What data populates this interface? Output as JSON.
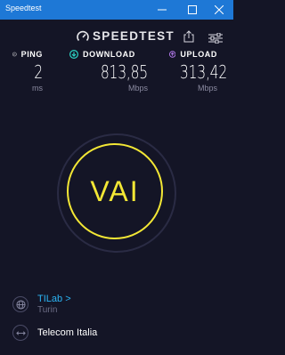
{
  "window": {
    "title": "Speedtest",
    "titlebar_color": "#1e78d6"
  },
  "header": {
    "logo_text": "SPEEDTEST",
    "logo_icon": "speedometer-icon",
    "share_icon": "share-icon",
    "settings_icon": "sliders-icon"
  },
  "metrics": {
    "ping": {
      "label": "PING",
      "value": "2",
      "unit": "ms",
      "icon": "ping-icon"
    },
    "download": {
      "label": "DOWNLOAD",
      "value": "813,85",
      "unit": "Mbps",
      "icon": "download-arrow-icon",
      "accent": "#2bd3c3"
    },
    "upload": {
      "label": "UPLOAD",
      "value": "313,42",
      "unit": "Mbps",
      "icon": "upload-arrow-icon",
      "accent": "#b87df2"
    }
  },
  "go_button": {
    "label": "VAI",
    "accent": "#f3e735"
  },
  "server": {
    "name": "TILab",
    "chevron": ">",
    "location": "Turin",
    "icon": "globe-icon"
  },
  "isp": {
    "name": "Telecom Italia",
    "icon": "connection-icon"
  },
  "colors": {
    "background": "#141526",
    "link": "#2bb3f3"
  }
}
